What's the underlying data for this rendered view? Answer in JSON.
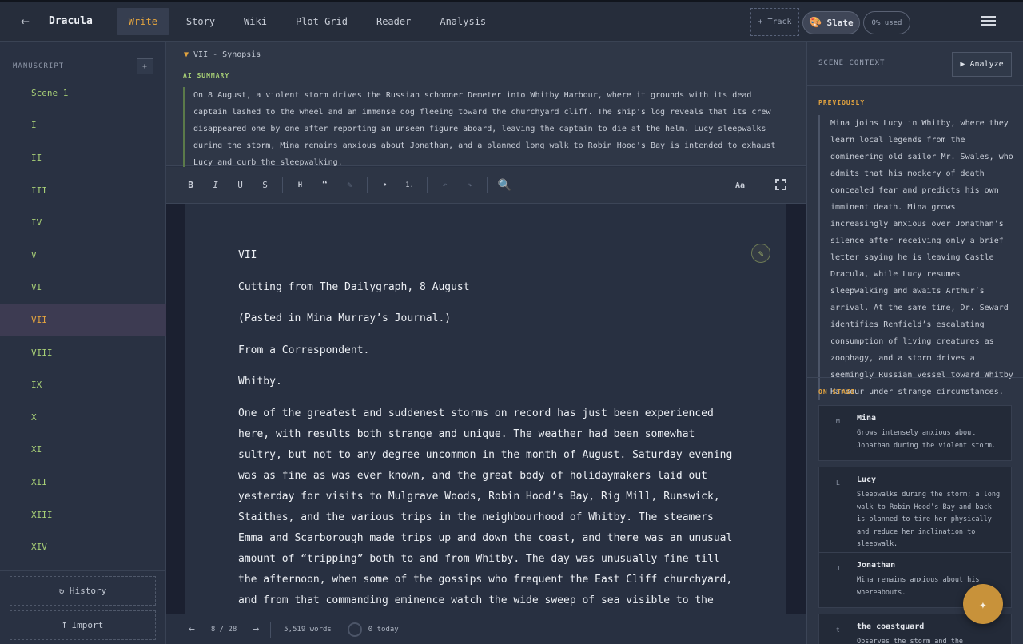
{
  "header": {
    "back_icon": "←",
    "title": "Dracula",
    "tabs": [
      {
        "label": "Write"
      },
      {
        "label": "Story"
      },
      {
        "label": "Wiki"
      },
      {
        "label": "Plot Grid"
      },
      {
        "label": "Reader"
      },
      {
        "label": "Analysis"
      }
    ],
    "track_label": "+ Track",
    "theme_label": "Slate",
    "usage_label": "0% used"
  },
  "sidebar": {
    "heading": "MANUSCRIPT",
    "add_label": "+",
    "scenes": [
      "Scene 1",
      "I",
      "II",
      "III",
      "IV",
      "V",
      "VI",
      "VII",
      "VIII",
      "IX",
      "X",
      "XI",
      "XII",
      "XIII",
      "XIV"
    ],
    "active_scene": "VII",
    "history_label": "↻ History",
    "import_label": "⭡ Import"
  },
  "synopsis": {
    "title": "VII - Synopsis",
    "ai_label": "AI SUMMARY",
    "text": "On 8 August, a violent storm drives the Russian schooner Demeter into Whitby Harbour, where it grounds with its dead captain lashed to the wheel and an immense dog fleeing toward the churchyard cliff. The ship's log reveals that its crew disappeared one by one after reporting an unseen figure aboard, leaving the captain to die at the helm. Lucy sleepwalks during the storm, Mina remains anxious about Jonathan, and a planned long walk to Robin Hood's Bay is intended to exhaust Lucy and curb the sleepwalking."
  },
  "toolbar": {
    "bold": "B",
    "italic": "I",
    "underline": "U",
    "strike": "S",
    "heading": "H",
    "quote": "❝",
    "clear": "✎",
    "bullet": "•",
    "numbered": "1.",
    "undo": "↶",
    "redo": "↷",
    "search_icon": "🔍",
    "font_label": "Aa"
  },
  "editor": {
    "paragraphs": [
      "VII",
      "Cutting from The Dailygraph, 8 August",
      "(Pasted in Mina Murray’s Journal.)",
      "From a Correspondent.",
      "Whitby.",
      "One of the greatest and suddenest storms on record has just been experienced here, with results both strange and unique. The weather had been somewhat sultry, but not to any degree uncommon in the month of August. Saturday evening was as fine as was ever known, and the great body of holidaymakers laid out yesterday for visits to Mulgrave Woods, Robin Hood’s Bay, Rig Mill, Runswick, Staithes, and the various trips in the neighbourhood of Whitby. The steamers Emma and Scarborough made trips up and down the coast, and there was an unusual amount of “tripping” both to and from Whitby. The day was unusually fine till the afternoon, when some of the gossips who frequent the East Cliff churchyard, and from that commanding eminence watch the wide sweep of sea visible to the north and east, called attention to a sudden show of “mares’-tails”"
    ],
    "edit_icon": "✎"
  },
  "status": {
    "prev": "←",
    "page": "8 / 28",
    "next": "→",
    "words": "5,519 words",
    "today": "0 today"
  },
  "context": {
    "heading": "SCENE CONTEXT",
    "analyze_label": "▶ Analyze",
    "previously_label": "PREVIOUSLY",
    "previously_text": "Mina joins Lucy in Whitby, where they learn local legends from the domineering old sailor Mr. Swales, who admits that his mockery of death concealed fear and predicts his own imminent death. Mina grows increasingly anxious over Jonathan’s silence after receiving only a brief letter saying he is leaving Castle Dracula, while Lucy resumes sleepwalking and awaits Arthur’s arrival. At the same time, Dr. Seward identifies Renfield’s escalating consumption of living creatures as zoophagy, and a storm drives a seemingly Russian vessel toward Whitby Harbour under strange circumstances.",
    "onstage_label": "ON STAGE",
    "characters": [
      {
        "initial": "M",
        "name": "Mina",
        "desc": "Grows intensely anxious about Jonathan during the violent storm."
      },
      {
        "initial": "L",
        "name": "Lucy",
        "desc": "Sleepwalks during the storm; a long walk to Robin Hood’s Bay and back is planned to tire her physically and reduce her inclination to sleepwalk."
      },
      {
        "initial": "J",
        "name": "Jonathan",
        "desc": "Mina remains anxious about his whereabouts."
      },
      {
        "initial": "t",
        "name": "the coastguard",
        "desc": "Observes the storm and the schooner’s"
      }
    ]
  },
  "fab_icon": "✦"
}
